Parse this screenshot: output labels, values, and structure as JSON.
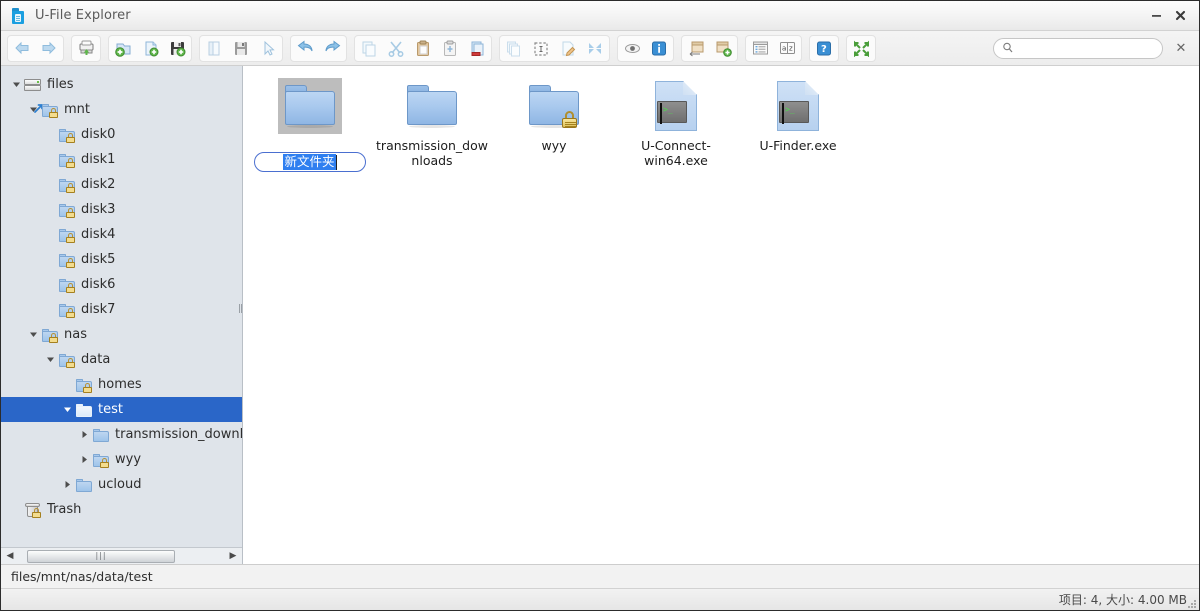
{
  "window": {
    "title": "U-File Explorer",
    "icon": "app-folder-icon",
    "minimize_label": "–",
    "close_label": "✕"
  },
  "toolbar": {
    "groups": [
      {
        "name": "navigation",
        "buttons": [
          {
            "id": "back",
            "icon": "arrow-left-icon",
            "label": "Back"
          },
          {
            "id": "forward",
            "icon": "arrow-right-icon",
            "label": "Forward"
          }
        ]
      },
      {
        "name": "transfer",
        "buttons": [
          {
            "id": "upload",
            "icon": "upload-drive-icon",
            "label": "Upload"
          }
        ]
      },
      {
        "name": "create",
        "buttons": [
          {
            "id": "new-folder",
            "icon": "new-folder-icon",
            "label": "New Folder"
          },
          {
            "id": "new-file",
            "icon": "new-file-icon",
            "label": "New File"
          },
          {
            "id": "save",
            "icon": "save-add-icon",
            "label": "Save"
          }
        ]
      },
      {
        "name": "document",
        "buttons": [
          {
            "id": "open",
            "icon": "open-book-icon",
            "label": "Open"
          },
          {
            "id": "save-as",
            "icon": "floppy-icon",
            "label": "Save As"
          },
          {
            "id": "select",
            "icon": "cursor-arrow-icon",
            "label": "Select"
          }
        ]
      },
      {
        "name": "history",
        "buttons": [
          {
            "id": "undo",
            "icon": "undo-icon",
            "label": "Undo"
          },
          {
            "id": "redo",
            "icon": "redo-icon",
            "label": "Redo"
          }
        ]
      },
      {
        "name": "clipboard",
        "buttons": [
          {
            "id": "copy",
            "icon": "copy-icon",
            "label": "Copy"
          },
          {
            "id": "cut",
            "icon": "scissors-icon",
            "label": "Cut"
          },
          {
            "id": "paste",
            "icon": "clipboard-icon",
            "label": "Paste"
          },
          {
            "id": "paste-special",
            "icon": "clipboard-move-icon",
            "label": "Paste Special"
          },
          {
            "id": "delete",
            "icon": "delete-file-icon",
            "label": "Delete"
          }
        ]
      },
      {
        "name": "edit",
        "buttons": [
          {
            "id": "duplicate",
            "icon": "duplicate-icon",
            "label": "Duplicate"
          },
          {
            "id": "select-all",
            "icon": "select-all-icon",
            "label": "Select All"
          },
          {
            "id": "rename",
            "icon": "rename-pencil-icon",
            "label": "Rename"
          },
          {
            "id": "expand",
            "icon": "expand-arrows-icon",
            "label": "Expand"
          }
        ]
      },
      {
        "name": "view",
        "buttons": [
          {
            "id": "preview",
            "icon": "eye-icon",
            "label": "Preview"
          },
          {
            "id": "info",
            "icon": "info-icon",
            "label": "Properties"
          }
        ]
      },
      {
        "name": "archive",
        "buttons": [
          {
            "id": "extract",
            "icon": "archive-icon",
            "label": "Extract"
          },
          {
            "id": "compress",
            "icon": "archive-add-icon",
            "label": "Compress"
          }
        ]
      },
      {
        "name": "listing",
        "buttons": [
          {
            "id": "list-view",
            "icon": "list-view-icon",
            "label": "List View"
          },
          {
            "id": "sort",
            "icon": "sort-az-icon",
            "label": "Sort"
          }
        ]
      },
      {
        "name": "help",
        "buttons": [
          {
            "id": "help",
            "icon": "help-question-icon",
            "label": "Help"
          }
        ]
      },
      {
        "name": "fullscreen",
        "buttons": [
          {
            "id": "fullscreen",
            "icon": "fullscreen-icon",
            "label": "Fullscreen"
          }
        ]
      }
    ],
    "search": {
      "value": "",
      "placeholder": "",
      "icon": "search-icon",
      "clear_label": "✕"
    }
  },
  "tree": {
    "items": [
      {
        "label": "files",
        "depth": 0,
        "icon": "drive-icon",
        "twisty": "down",
        "lock": false,
        "selected": false
      },
      {
        "label": "mnt",
        "depth": 1,
        "icon": "folder-shortcut-icon",
        "twisty": "down",
        "lock": true,
        "selected": false
      },
      {
        "label": "disk0",
        "depth": 2,
        "icon": "folder-icon",
        "twisty": "none",
        "lock": true,
        "selected": false
      },
      {
        "label": "disk1",
        "depth": 2,
        "icon": "folder-icon",
        "twisty": "none",
        "lock": true,
        "selected": false
      },
      {
        "label": "disk2",
        "depth": 2,
        "icon": "folder-icon",
        "twisty": "none",
        "lock": true,
        "selected": false
      },
      {
        "label": "disk3",
        "depth": 2,
        "icon": "folder-icon",
        "twisty": "none",
        "lock": true,
        "selected": false
      },
      {
        "label": "disk4",
        "depth": 2,
        "icon": "folder-icon",
        "twisty": "none",
        "lock": true,
        "selected": false
      },
      {
        "label": "disk5",
        "depth": 2,
        "icon": "folder-icon",
        "twisty": "none",
        "lock": true,
        "selected": false
      },
      {
        "label": "disk6",
        "depth": 2,
        "icon": "folder-icon",
        "twisty": "none",
        "lock": true,
        "selected": false
      },
      {
        "label": "disk7",
        "depth": 2,
        "icon": "folder-icon",
        "twisty": "none",
        "lock": true,
        "selected": false
      },
      {
        "label": "nas",
        "depth": 1,
        "icon": "folder-icon",
        "twisty": "down",
        "lock": true,
        "selected": false
      },
      {
        "label": "data",
        "depth": 2,
        "icon": "folder-icon",
        "twisty": "down",
        "lock": true,
        "selected": false
      },
      {
        "label": "homes",
        "depth": 3,
        "icon": "folder-icon",
        "twisty": "none",
        "lock": true,
        "selected": false
      },
      {
        "label": "test",
        "depth": 3,
        "icon": "folder-open-icon",
        "twisty": "down",
        "lock": false,
        "selected": true
      },
      {
        "label": "transmission_downloa",
        "depth": 4,
        "icon": "folder-icon",
        "twisty": "right",
        "lock": false,
        "selected": false
      },
      {
        "label": "wyy",
        "depth": 4,
        "icon": "folder-icon",
        "twisty": "right",
        "lock": true,
        "selected": false
      },
      {
        "label": "ucloud",
        "depth": 3,
        "icon": "folder-icon",
        "twisty": "right",
        "lock": false,
        "selected": false
      },
      {
        "label": "Trash",
        "depth": 0,
        "icon": "trash-icon",
        "twisty": "none",
        "lock": true,
        "selected": false
      }
    ],
    "hscroll": {
      "left_arrow": "◀",
      "right_arrow": "▶",
      "thumb_grip": "|||"
    }
  },
  "files": {
    "items": [
      {
        "name": "",
        "editing_value": "新文件夹",
        "type": "folder",
        "icon": "folder-icon",
        "lock": false,
        "selected": true
      },
      {
        "name": "transmission_downloads",
        "type": "folder",
        "icon": "folder-icon",
        "lock": false,
        "selected": false
      },
      {
        "name": "wyy",
        "type": "folder",
        "icon": "folder-locked-icon",
        "lock": true,
        "selected": false
      },
      {
        "name": "U-Connect-win64.exe",
        "type": "executable",
        "icon": "exe-terminal-icon",
        "lock": false,
        "selected": false
      },
      {
        "name": "U-Finder.exe",
        "type": "executable",
        "icon": "exe-terminal-icon",
        "lock": false,
        "selected": false
      }
    ]
  },
  "pathbar": {
    "path": "files/mnt/nas/data/test"
  },
  "statusbar": {
    "text": "项目: 4, 大小: 4.00 MB"
  },
  "colors": {
    "selection_blue": "#2a66c8",
    "titlebar": "#f3f3f3",
    "tree_bg": "#dfe4ea",
    "file_bg": "#ffffff"
  }
}
